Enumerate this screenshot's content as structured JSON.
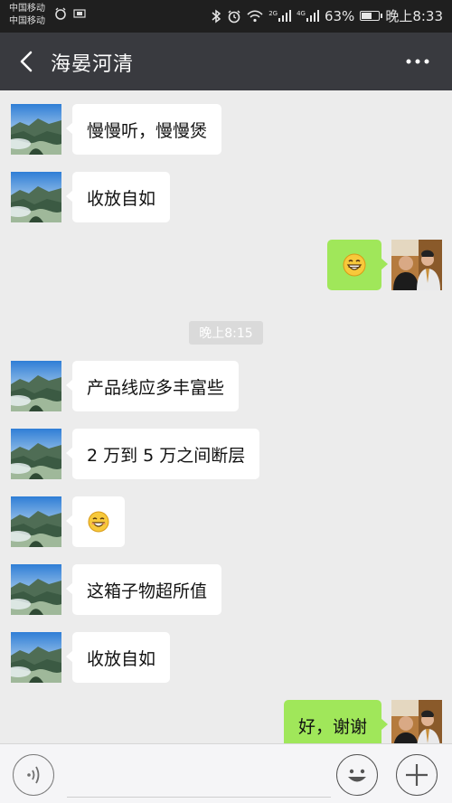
{
  "status_bar": {
    "carrier1": "中国移动",
    "carrier2": "中国移动",
    "net_label_1": "2G",
    "net_label_2": "4G",
    "battery_text": "63%",
    "battery_level": 0.63,
    "time": "晚上8:33",
    "icons": [
      "alarm-clock-icon",
      "usb-icon",
      "bluetooth-icon",
      "alarm-icon",
      "wifi-icon",
      "signal-icon",
      "battery-icon"
    ]
  },
  "header": {
    "title": "海晏河清",
    "back_icon": "back-chevron-icon",
    "more_icon": "more-dots-icon"
  },
  "chat": {
    "messages": [
      {
        "side": "in",
        "text": "慢慢听，慢慢煲"
      },
      {
        "side": "in",
        "text": "收放自如"
      },
      {
        "side": "out",
        "emoji": "grinning-face-icon"
      },
      {
        "timestamp": "晚上8:15"
      },
      {
        "side": "in",
        "text": "产品线应多丰富些"
      },
      {
        "side": "in",
        "text": "2 万到 5 万之间断层"
      },
      {
        "side": "in",
        "emoji": "smiling-face-icon"
      },
      {
        "side": "in",
        "text": "这箱子物超所值"
      },
      {
        "side": "in",
        "text": "收放自如"
      },
      {
        "side": "out",
        "text": "好，谢谢"
      }
    ]
  },
  "input_bar": {
    "placeholder": "",
    "value": "",
    "voice_icon": "voice-icon",
    "emoji_icon": "emoji-icon",
    "plus_icon": "plus-icon"
  },
  "colors": {
    "header_bg": "#393a3f",
    "status_bg": "#1f1f1f",
    "chat_bg": "#ececec",
    "out_bubble": "#a0e75a",
    "in_bubble": "#ffffff"
  }
}
